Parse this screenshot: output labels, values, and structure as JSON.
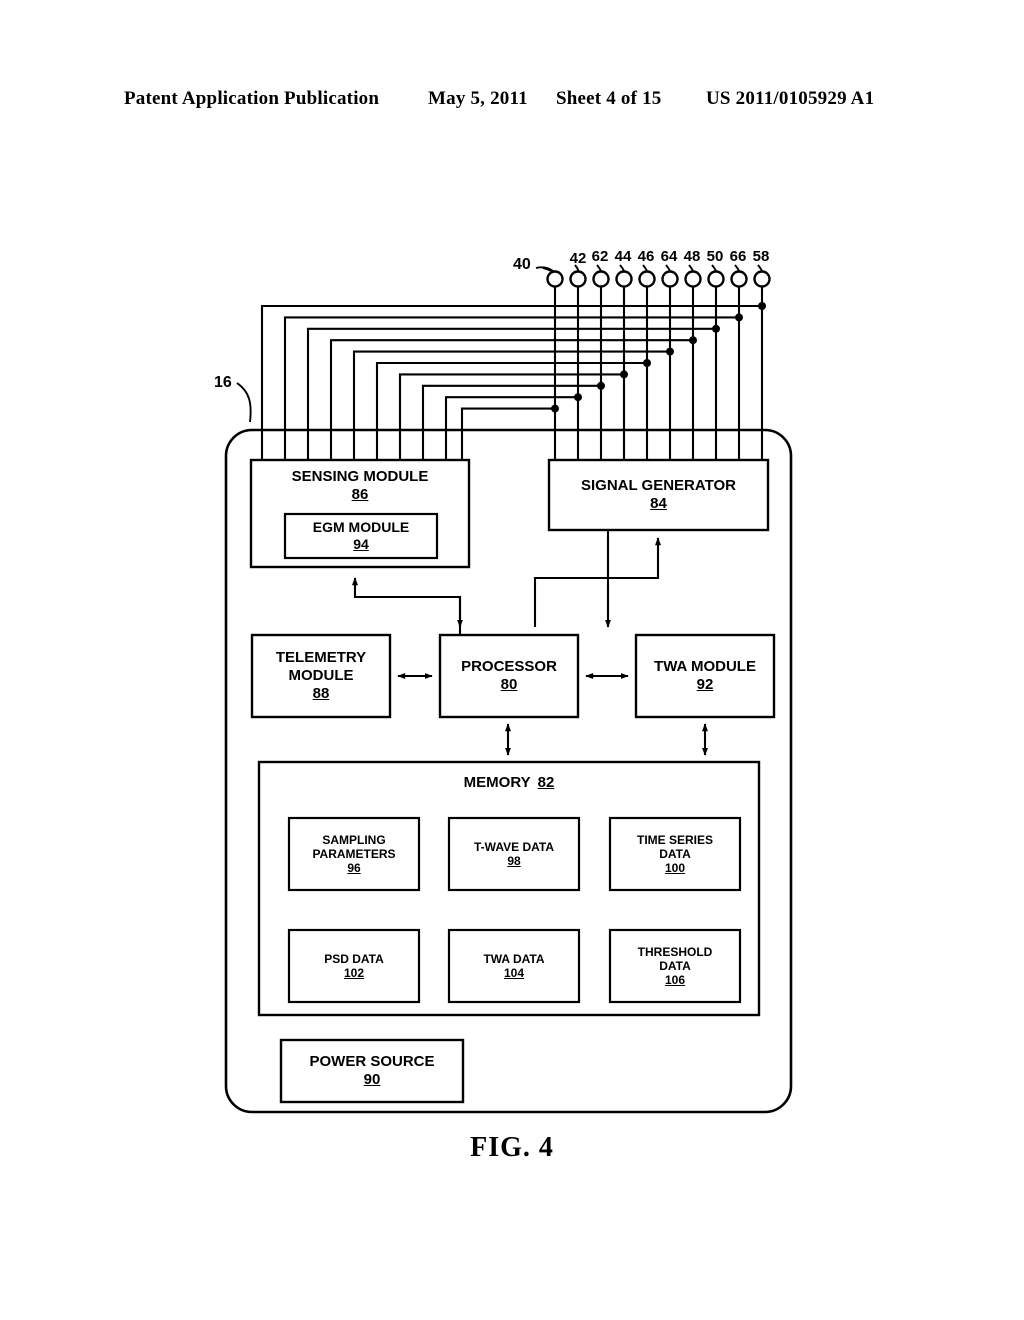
{
  "header": {
    "publication": "Patent Application Publication",
    "date": "May 5, 2011",
    "sheet": "Sheet 4 of 15",
    "patent_number": "US 2011/0105929 A1"
  },
  "figure": {
    "caption": "FIG. 4",
    "device_ref": "16",
    "connector_block_ref": "40"
  },
  "terminals": [
    {
      "label": "42"
    },
    {
      "label": "62"
    },
    {
      "label": "44"
    },
    {
      "label": "46"
    },
    {
      "label": "64"
    },
    {
      "label": "48"
    },
    {
      "label": "50"
    },
    {
      "label": "66"
    },
    {
      "label": "58"
    }
  ],
  "blocks": {
    "sensing_module": {
      "title": "SENSING MODULE",
      "ref": "86"
    },
    "egm_module": {
      "title": "EGM MODULE",
      "ref": "94"
    },
    "signal_generator": {
      "title": "SIGNAL GENERATOR",
      "ref": "84"
    },
    "telemetry_module": {
      "title_line1": "TELEMETRY",
      "title_line2": "MODULE",
      "ref": "88"
    },
    "processor": {
      "title": "PROCESSOR",
      "ref": "80"
    },
    "twa_module": {
      "title": "TWA MODULE",
      "ref": "92"
    },
    "memory": {
      "title": "MEMORY",
      "ref": "82"
    },
    "power_source": {
      "title": "POWER SOURCE",
      "ref": "90"
    }
  },
  "memory_items": [
    {
      "line1": "SAMPLING",
      "line2": "PARAMETERS",
      "line3": "",
      "ref": "96"
    },
    {
      "line1": "T-WAVE DATA",
      "line2": "",
      "line3": "",
      "ref": "98"
    },
    {
      "line1": "TIME SERIES",
      "line2": "DATA",
      "line3": "",
      "ref": "100"
    },
    {
      "line1": "PSD DATA",
      "line2": "",
      "line3": "",
      "ref": "102"
    },
    {
      "line1": "TWA DATA",
      "line2": "",
      "line3": "",
      "ref": "104"
    },
    {
      "line1": "THRESHOLD",
      "line2": "DATA",
      "line3": "",
      "ref": "106"
    }
  ],
  "colors": {
    "ink": "#000000",
    "paper": "#ffffff"
  }
}
